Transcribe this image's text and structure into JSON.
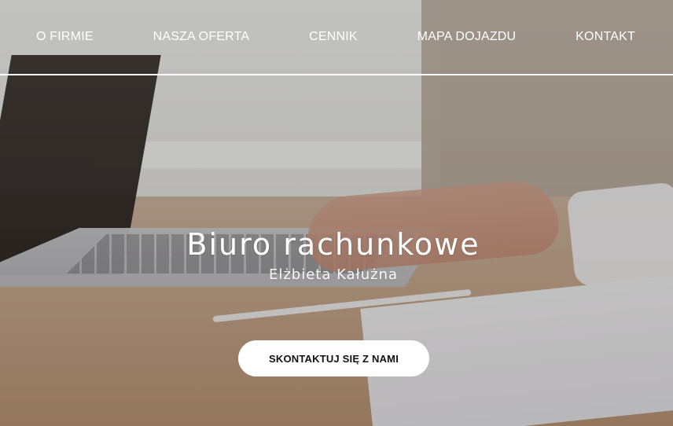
{
  "nav": {
    "items": [
      {
        "label": "O FIRMIE"
      },
      {
        "label": "NASZA OFERTA"
      },
      {
        "label": "CENNIK"
      },
      {
        "label": "MAPA DOJAZDU"
      },
      {
        "label": "KONTAKT"
      }
    ]
  },
  "hero": {
    "title": "Biuro rachunkowe",
    "subtitle": "Elżbieta Kałużna",
    "cta_label": "SKONTAKTUJ SIĘ Z NAMI"
  }
}
